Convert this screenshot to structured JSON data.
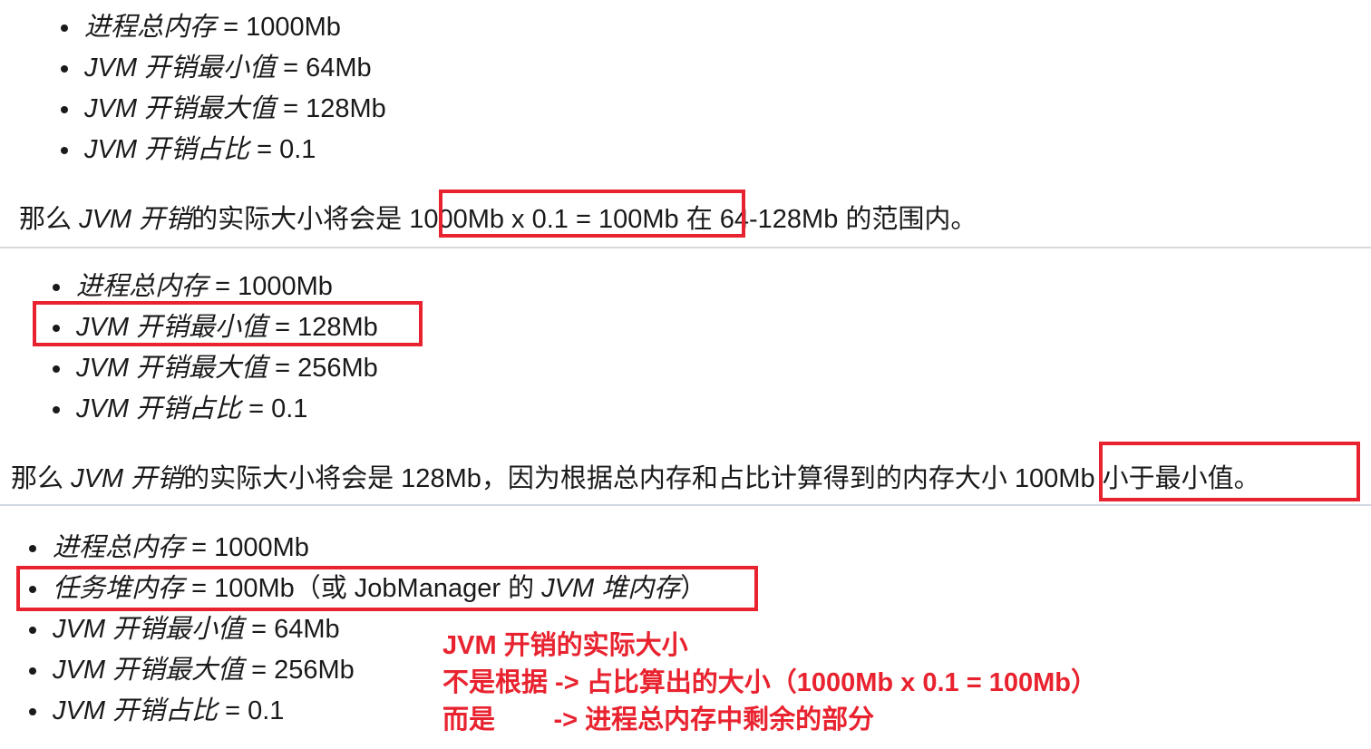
{
  "panel1": {
    "items": [
      {
        "term": "进程总内存",
        "value": " = 1000Mb"
      },
      {
        "term": "JVM 开销最小值",
        "value": " = 64Mb"
      },
      {
        "term": "JVM 开销最大值",
        "value": " = 128Mb"
      },
      {
        "term": "JVM 开销占比",
        "value": " = 0.1"
      }
    ],
    "para": {
      "prefix": "那么 ",
      "term": "JVM 开销",
      "middle": "的实际大小将会是 ",
      "highlight": "1000Mb x 0.1 = 100Mb",
      "suffix": "  在 64-128Mb 的范围内。"
    }
  },
  "panel2": {
    "items": [
      {
        "term": "进程总内存",
        "value": " = 1000Mb"
      },
      {
        "term": "JVM 开销最小值",
        "value": " = 128Mb"
      },
      {
        "term": "JVM 开销最大值",
        "value": " = 256Mb"
      },
      {
        "term": "JVM 开销占比",
        "value": " = 0.1"
      }
    ],
    "para": {
      "prefix": "那么 ",
      "term": "JVM 开销",
      "middle": "的实际大小将会是 128Mb，因为根据总内存和占比计算得到的内存大小 ",
      "highlight": "100Mb 小于最小值。"
    }
  },
  "panel3": {
    "items": [
      {
        "term": "进程总内存",
        "value": " = 1000Mb"
      },
      {
        "term": "任务堆内存",
        "value": " = 100Mb（或 JobManager 的 ",
        "term2": "JVM 堆内存",
        "tail": "）"
      },
      {
        "term": "JVM 开销最小值",
        "value": " = 64Mb"
      },
      {
        "term": "JVM 开销最大值",
        "value": " = 256Mb"
      },
      {
        "term": "JVM 开销占比",
        "value": " = 0.1"
      }
    ],
    "note": {
      "line1": "JVM 开销的实际大小",
      "line2": "不是根据 -> 占比算出的大小（1000Mb x 0.1 = 100Mb）",
      "line3": "而是        -> 进程总内存中剩余的部分"
    }
  },
  "colors": {
    "highlight_box": "#e8232f",
    "note_text": "#e8232f",
    "text": "#1a1a1a"
  }
}
